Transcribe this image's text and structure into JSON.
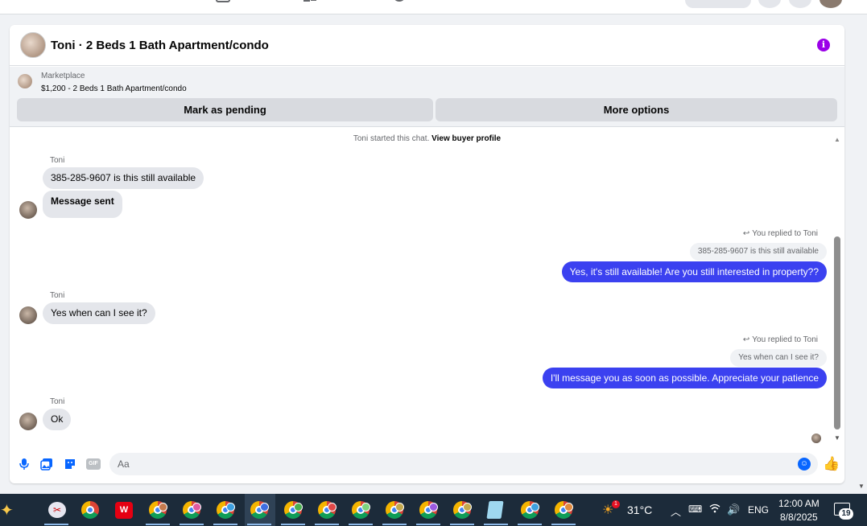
{
  "header": {
    "title": "Toni · 2 Beds 1 Bath Apartment/condo",
    "info_icon": "i"
  },
  "listing": {
    "category": "Marketplace",
    "price_title": "$1,200 - 2 Beds 1 Bath Apartment/condo",
    "pending_label": "Mark as pending",
    "more_label": "More options"
  },
  "chat_start": {
    "text": "Toni started this chat.",
    "link": "View buyer profile"
  },
  "messages": {
    "m1_sender": "Toni",
    "m1_text": "385-285-9607 is this still available",
    "m2_text": "Message sent",
    "r1_label": "You replied to Toni",
    "r1_quote": "385-285-9607 is this still available",
    "r1_text": "Yes, it's still available! Are you still interested in property??",
    "m3_sender": "Toni",
    "m3_text": "Yes when can I see it?",
    "r2_label": "You replied to Toni",
    "r2_quote": "Yes when can I see it?",
    "r2_text": "I'll message you as soon as possible. Appreciate your patience",
    "m4_sender": "Toni",
    "m4_text": "Ok"
  },
  "composer": {
    "placeholder": "Aa",
    "gif_label": "GIF"
  },
  "taskbar": {
    "weather_badge": "1",
    "temperature": "31°C",
    "language": "ENG",
    "time": "12:00 AM",
    "date": "8/8/2025",
    "notification_count": "19"
  },
  "colors": {
    "accent": "#0866ff",
    "outgoing_bubble": "#3b41f0",
    "info": "#9b00e8",
    "taskbar": "#1c2b3a"
  }
}
